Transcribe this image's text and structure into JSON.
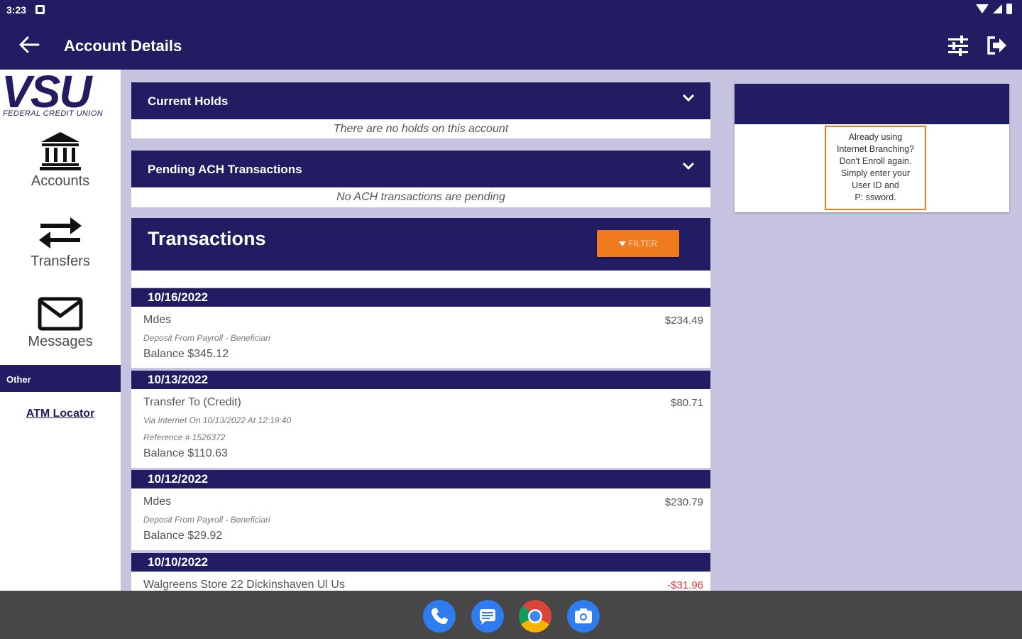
{
  "status_bar": {
    "time": "3:23"
  },
  "app_bar": {
    "title": "Account Details"
  },
  "sidebar": {
    "logo_text": "VSU",
    "logo_subtitle": "FEDERAL CREDIT UNION",
    "items": [
      {
        "label": "Accounts",
        "icon": "bank-icon"
      },
      {
        "label": "Transfers",
        "icon": "swap-arrows-icon"
      },
      {
        "label": "Messages",
        "icon": "envelope-icon"
      }
    ],
    "section_label": "Other",
    "atm_link": "ATM Locator"
  },
  "holds": {
    "title": "Current Holds",
    "message": "There are no holds on this account"
  },
  "ach": {
    "title": "Pending ACH Transactions",
    "message": "No ACH transactions are pending"
  },
  "transactions": {
    "title": "Transactions",
    "filter_label": "FILTER",
    "groups": [
      {
        "date": "10/16/2022",
        "description": "Mdes",
        "amount": "$234.49",
        "memos": [
          "Deposit From Payroll - Beneficiari"
        ],
        "balance": "Balance  $345.12"
      },
      {
        "date": "10/13/2022",
        "description": "Transfer To (Credit)",
        "amount": "$80.71",
        "memos": [
          "Via Internet On 10/13/2022 At 12:19:40",
          "Reference # 1526372"
        ],
        "balance": "Balance  $110.63"
      },
      {
        "date": "10/12/2022",
        "description": "Mdes",
        "amount": "$230.79",
        "memos": [
          "Deposit From Payroll - Beneficiari"
        ],
        "balance": "Balance  $29.92"
      },
      {
        "date": "10/10/2022",
        "description": "Walgreens Store 22 Dickinshaven Ul Us",
        "amount": "-$31.96"
      }
    ]
  },
  "promo": {
    "lines": [
      "Already using",
      "Internet Branching?",
      "Don't Enroll again.",
      "Simply enter your",
      "User ID and",
      "P:   ssword."
    ]
  },
  "dock": [
    "phone-icon",
    "messages-icon",
    "chrome-icon",
    "camera-icon"
  ],
  "colors": {
    "primary": "#221d63",
    "accent": "#f07a1e",
    "background": "#c6c4e1",
    "negative": "#e23a3a"
  }
}
